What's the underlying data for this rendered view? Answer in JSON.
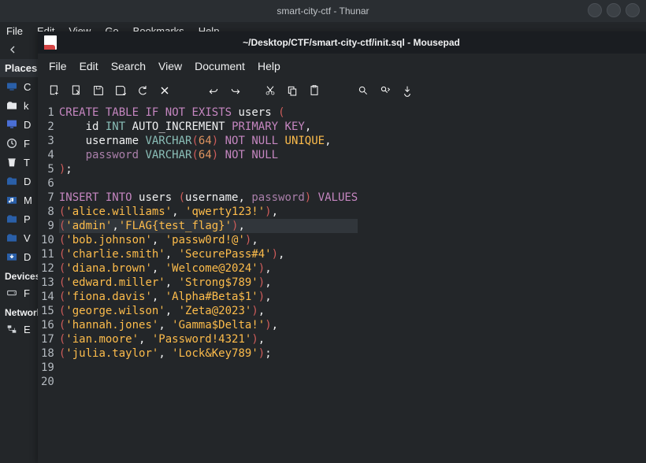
{
  "thunar": {
    "title": "smart-city-ctf - Thunar",
    "menus": [
      "File",
      "Edit",
      "View",
      "Go",
      "Bookmarks",
      "Help"
    ],
    "places_heading": "Places",
    "devices_heading": "Devices",
    "network_heading": "Network",
    "places": [
      {
        "icon": "computer",
        "label": "C"
      },
      {
        "icon": "folder-home",
        "label": "k"
      },
      {
        "icon": "desktop",
        "label": "D"
      },
      {
        "icon": "clock",
        "label": "F"
      },
      {
        "icon": "trash",
        "label": "T"
      },
      {
        "icon": "folder-blue",
        "label": "D"
      },
      {
        "icon": "music",
        "label": "M"
      },
      {
        "icon": "folder-blue",
        "label": "P"
      },
      {
        "icon": "folder-blue",
        "label": "V"
      },
      {
        "icon": "downloads",
        "label": "D"
      }
    ],
    "devices": [
      {
        "icon": "drive",
        "label": "F"
      }
    ],
    "network": [
      {
        "icon": "network",
        "label": "E"
      }
    ]
  },
  "mousepad": {
    "title": "~/Desktop/CTF/smart-city-ctf/init.sql - Mousepad",
    "menus": [
      "File",
      "Edit",
      "Search",
      "View",
      "Document",
      "Help"
    ],
    "toolbar": [
      "new",
      "open",
      "save",
      "saveas",
      "reload",
      "close",
      "undo",
      "redo",
      "cut",
      "copy",
      "paste",
      "find",
      "find-replace",
      "goto"
    ]
  },
  "code_raw": [
    "CREATE TABLE IF NOT EXISTS users (",
    "    id INT AUTO_INCREMENT PRIMARY KEY,",
    "    username VARCHAR(64) NOT NULL UNIQUE,",
    "    password VARCHAR(64) NOT NULL",
    ");",
    "",
    "INSERT INTO users (username, password) VALUES",
    "('alice.williams', 'qwerty123!'),",
    "('admin','FLAG{test_flag}'),",
    "('bob.johnson', 'passw0rd!@'),",
    "('charlie.smith', 'SecurePass#4'),",
    "('diana.brown', 'Welcome@2024'),",
    "('edward.miller', 'Strong$789'),",
    "('fiona.davis', 'Alpha#Beta$1'),",
    "('george.wilson', 'Zeta@2023'),",
    "('hannah.jones', 'Gamma$Delta!'),",
    "('ian.moore', 'Password!4321'),",
    "('julia.taylor', 'Lock&Key789');",
    "",
    ""
  ],
  "highlight_line": 9,
  "code_html": [
    "<span class='kw'>CREATE</span> <span class='kw'>TABLE</span> <span class='kw'>IF</span> <span class='kw'>NOT</span> <span class='kw'>EXISTS</span> users <span class='punct-r'>(</span>",
    "    id <span class='type'>INT</span> <span class='ident'>AUTO_INCREMENT</span> <span class='kw'>PRIMARY</span> <span class='kw'>KEY</span>,",
    "    username <span class='type'>VARCHAR</span><span class='punct-r'>(</span><span class='num'>64</span><span class='punct-r'>)</span> <span class='kw'>NOT</span> <span class='kw'>NULL</span> <span class='kw2'>UNIQUE</span>,",
    "    <span class='col-pw'>password</span> <span class='type'>VARCHAR</span><span class='punct-r'>(</span><span class='num'>64</span><span class='punct-r'>)</span> <span class='kw'>NOT</span> <span class='kw'>NULL</span>",
    "<span class='punct-r'>)</span>;",
    "",
    "<span class='kw'>INSERT</span> <span class='kw'>INTO</span> users <span class='punct-r'>(</span>username, <span class='col-pw'>password</span><span class='punct-r'>)</span> <span class='kw'>VALUES</span>",
    "<span class='punct-r'>(</span><span class='str'>'alice.williams'</span>, <span class='str'>'qwerty123!'</span><span class='punct-r'>)</span>,",
    "<span class='punct-r'>(</span><span class='str'>'admin'</span>,<span class='str'>'FLAG{test_flag}'</span><span class='punct-r'>)</span>,",
    "<span class='punct-r'>(</span><span class='str'>'bob.johnson'</span>, <span class='str'>'passw0rd!@'</span><span class='punct-r'>)</span>,",
    "<span class='punct-r'>(</span><span class='str'>'charlie.smith'</span>, <span class='str'>'SecurePass#4'</span><span class='punct-r'>)</span>,",
    "<span class='punct-r'>(</span><span class='str'>'diana.brown'</span>, <span class='str'>'Welcome@2024'</span><span class='punct-r'>)</span>,",
    "<span class='punct-r'>(</span><span class='str'>'edward.miller'</span>, <span class='str'>'Strong$789'</span><span class='punct-r'>)</span>,",
    "<span class='punct-r'>(</span><span class='str'>'fiona.davis'</span>, <span class='str'>'Alpha#Beta$1'</span><span class='punct-r'>)</span>,",
    "<span class='punct-r'>(</span><span class='str'>'george.wilson'</span>, <span class='str'>'Zeta@2023'</span><span class='punct-r'>)</span>,",
    "<span class='punct-r'>(</span><span class='str'>'hannah.jones'</span>, <span class='str'>'Gamma$Delta!'</span><span class='punct-r'>)</span>,",
    "<span class='punct-r'>(</span><span class='str'>'ian.moore'</span>, <span class='str'>'Password!4321'</span><span class='punct-r'>)</span>,",
    "<span class='punct-r'>(</span><span class='str'>'julia.taylor'</span>, <span class='str'>'Lock&amp;Key789'</span><span class='punct-r'>)</span>;",
    "",
    ""
  ]
}
